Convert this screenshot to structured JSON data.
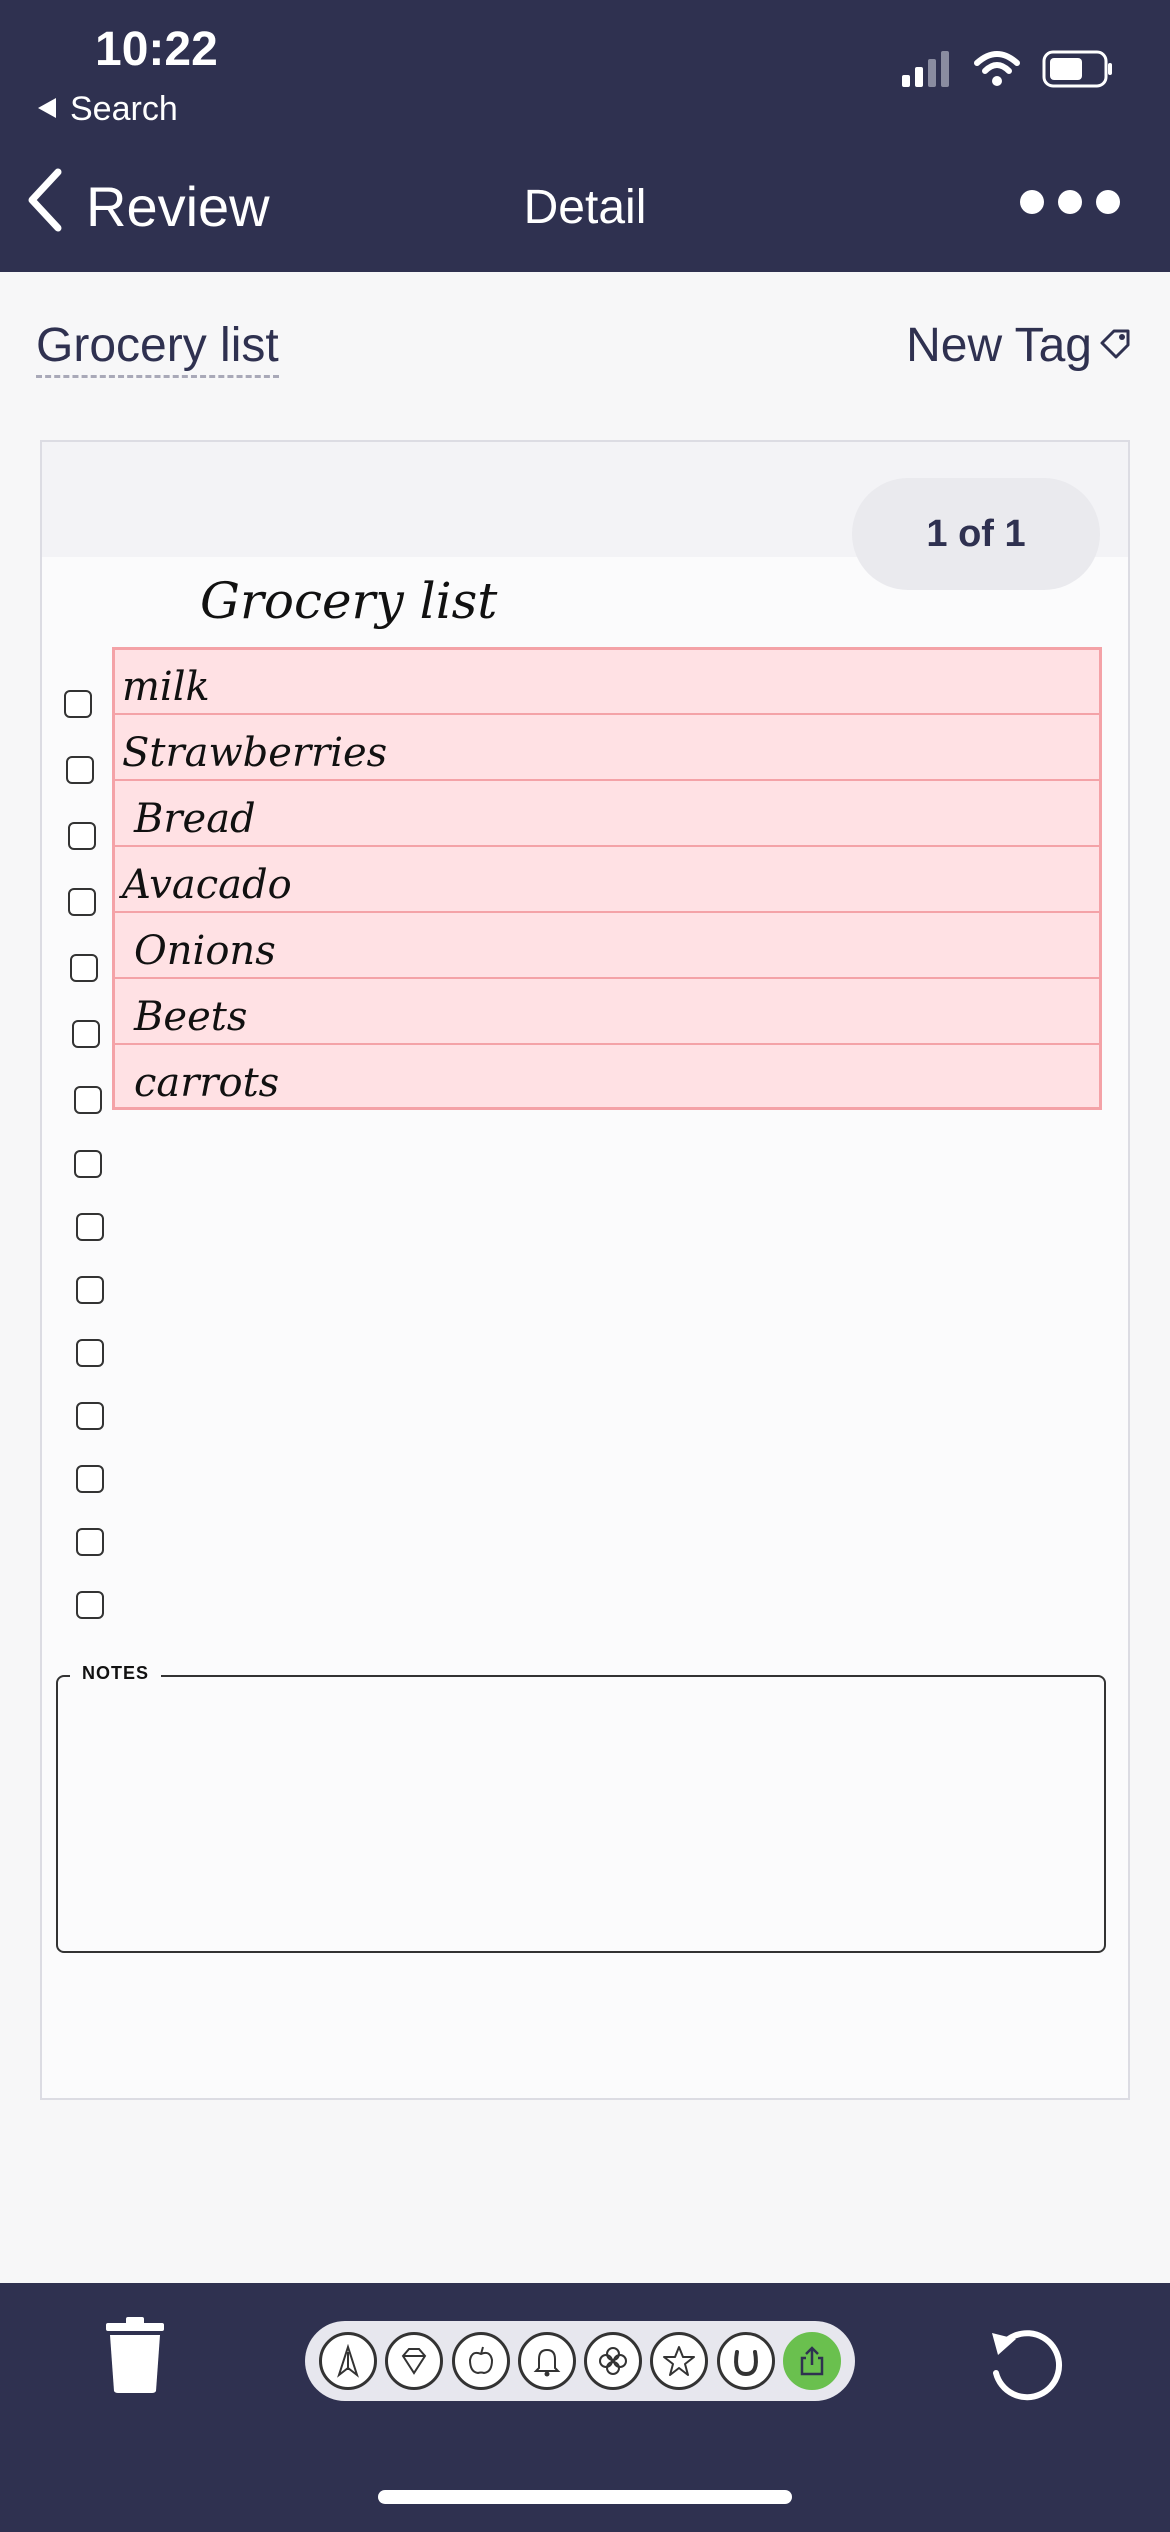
{
  "status_bar": {
    "time": "10:22",
    "back_app": "Search"
  },
  "nav": {
    "back_label": "Review",
    "title": "Detail"
  },
  "document": {
    "title": "Grocery list",
    "new_tag_label": "New Tag",
    "page_indicator": "1 of 1"
  },
  "page": {
    "handwritten_title": "Grocery list",
    "items": [
      "milk",
      "Strawberries",
      "Bread",
      "Avacado",
      "Onions",
      "Beets",
      "carrots"
    ],
    "notes_label": "NOTES"
  },
  "bottom_toolbar": {
    "icons": [
      "pencil-icon",
      "diamond-icon",
      "apple-icon",
      "bell-icon",
      "clover-icon",
      "star-icon",
      "horseshoe-icon",
      "share-icon"
    ]
  },
  "colors": {
    "bar": "#2f3150",
    "highlight": "#ffe1e4",
    "highlight_border": "#f4a2a7",
    "share": "#6ac04e"
  }
}
